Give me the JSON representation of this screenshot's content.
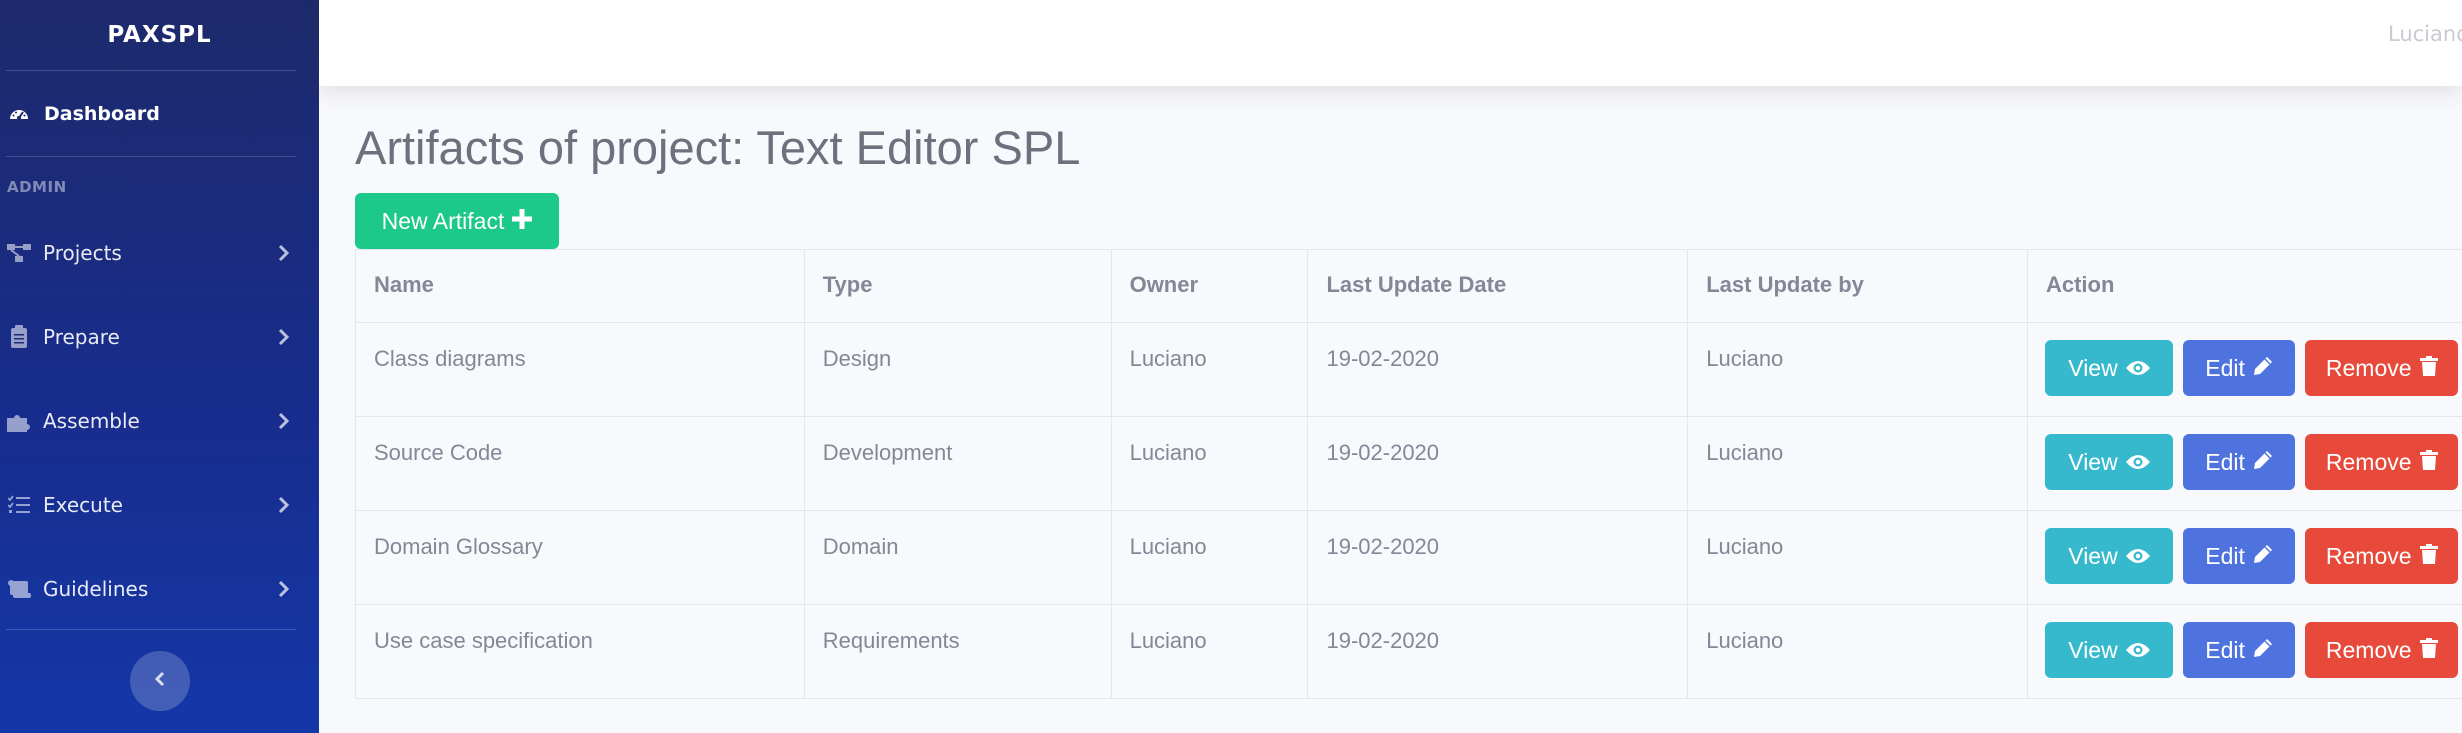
{
  "sidebar": {
    "brand": "PAXSPL",
    "dashboard": "Dashboard",
    "heading": "ADMIN",
    "items": [
      {
        "label": "Projects",
        "icon": "project-diagram-icon"
      },
      {
        "label": "Prepare",
        "icon": "clipboard-icon"
      },
      {
        "label": "Assemble",
        "icon": "puzzle-icon"
      },
      {
        "label": "Execute",
        "icon": "tasks-icon"
      },
      {
        "label": "Guidelines",
        "icon": "scroll-icon"
      }
    ]
  },
  "topbar": {
    "user": "Luciano"
  },
  "main": {
    "title": "Artifacts of project: Text Editor SPL",
    "new_button": "New Artifact",
    "columns": [
      "Name",
      "Type",
      "Owner",
      "Last Update Date",
      "Last Update by",
      "Action"
    ],
    "rows": [
      {
        "name": "Class diagrams",
        "type": "Design",
        "owner": "Luciano",
        "date": "19-02-2020",
        "by": "Luciano"
      },
      {
        "name": "Source Code",
        "type": "Development",
        "owner": "Luciano",
        "date": "19-02-2020",
        "by": "Luciano"
      },
      {
        "name": "Domain Glossary",
        "type": "Domain",
        "owner": "Luciano",
        "date": "19-02-2020",
        "by": "Luciano"
      },
      {
        "name": "Use case specification",
        "type": "Requirements",
        "owner": "Luciano",
        "date": "19-02-2020",
        "by": "Luciano"
      }
    ],
    "actions": {
      "view": "View",
      "edit": "Edit",
      "remove": "Remove"
    }
  },
  "colors": {
    "sidebar": "#1d2a6b",
    "success": "#1cc88a",
    "info": "#36b9cc",
    "primary": "#4e73df",
    "danger": "#e74a3b"
  }
}
